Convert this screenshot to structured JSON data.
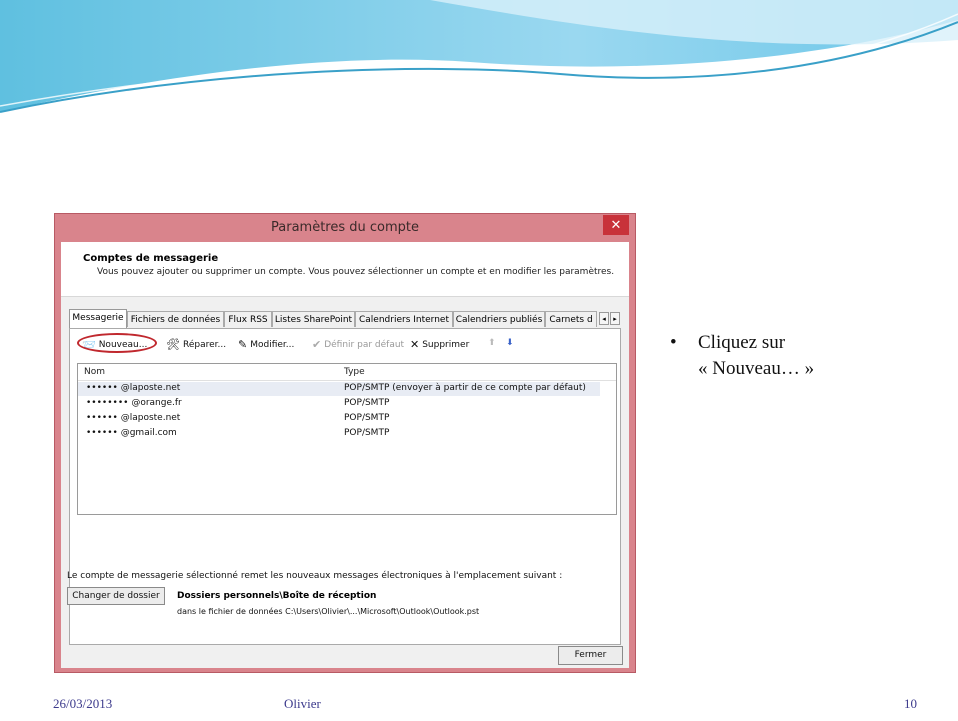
{
  "dialog": {
    "title": "Paramètres du compte",
    "close_glyph": "✕",
    "header_title": "Comptes de messagerie",
    "header_desc": "Vous pouvez ajouter ou supprimer un compte. Vous pouvez sélectionner un compte et en modifier les paramètres.",
    "tabs": [
      "Messagerie",
      "Fichiers de données",
      "Flux RSS",
      "Listes SharePoint",
      "Calendriers Internet",
      "Calendriers publiés",
      "Carnets d"
    ],
    "toolbar": {
      "new": "Nouveau...",
      "repair": "Réparer...",
      "modify": "Modifier...",
      "set_default": "Définir par défaut",
      "delete": "Supprimer"
    },
    "list": {
      "col_name": "Nom",
      "col_type": "Type",
      "rows": [
        {
          "name": "•••••• @laposte.net",
          "type": "POP/SMTP (envoyer à partir de ce compte par défaut)"
        },
        {
          "name": "••••••••  @orange.fr",
          "type": "POP/SMTP"
        },
        {
          "name": "•••••• @laposte.net",
          "type": "POP/SMTP"
        },
        {
          "name": "••••••  @gmail.com",
          "type": "POP/SMTP"
        }
      ]
    },
    "delivery_text": "Le compte de messagerie sélectionné remet les nouveaux messages électroniques à l'emplacement suivant :",
    "change_folder_button": "Changer de dossier",
    "folder_name": "Dossiers personnels\\Boîte de réception",
    "folder_path": "dans le fichier de données C:\\Users\\Olivier\\...\\Microsoft\\Outlook\\Outlook.pst",
    "close_button": "Fermer"
  },
  "slide": {
    "bullet_glyph": "•",
    "bullet_line1": "Cliquez sur",
    "bullet_line2": "« Nouveau… »",
    "footer_date": "26/03/2013",
    "footer_author": "Olivier",
    "footer_page": "10"
  },
  "colors": {
    "dialog_frame": "#d9848c",
    "close_red": "#c8323a",
    "highlight_circle": "#c0282e",
    "footer_text": "#3c3a8c"
  }
}
